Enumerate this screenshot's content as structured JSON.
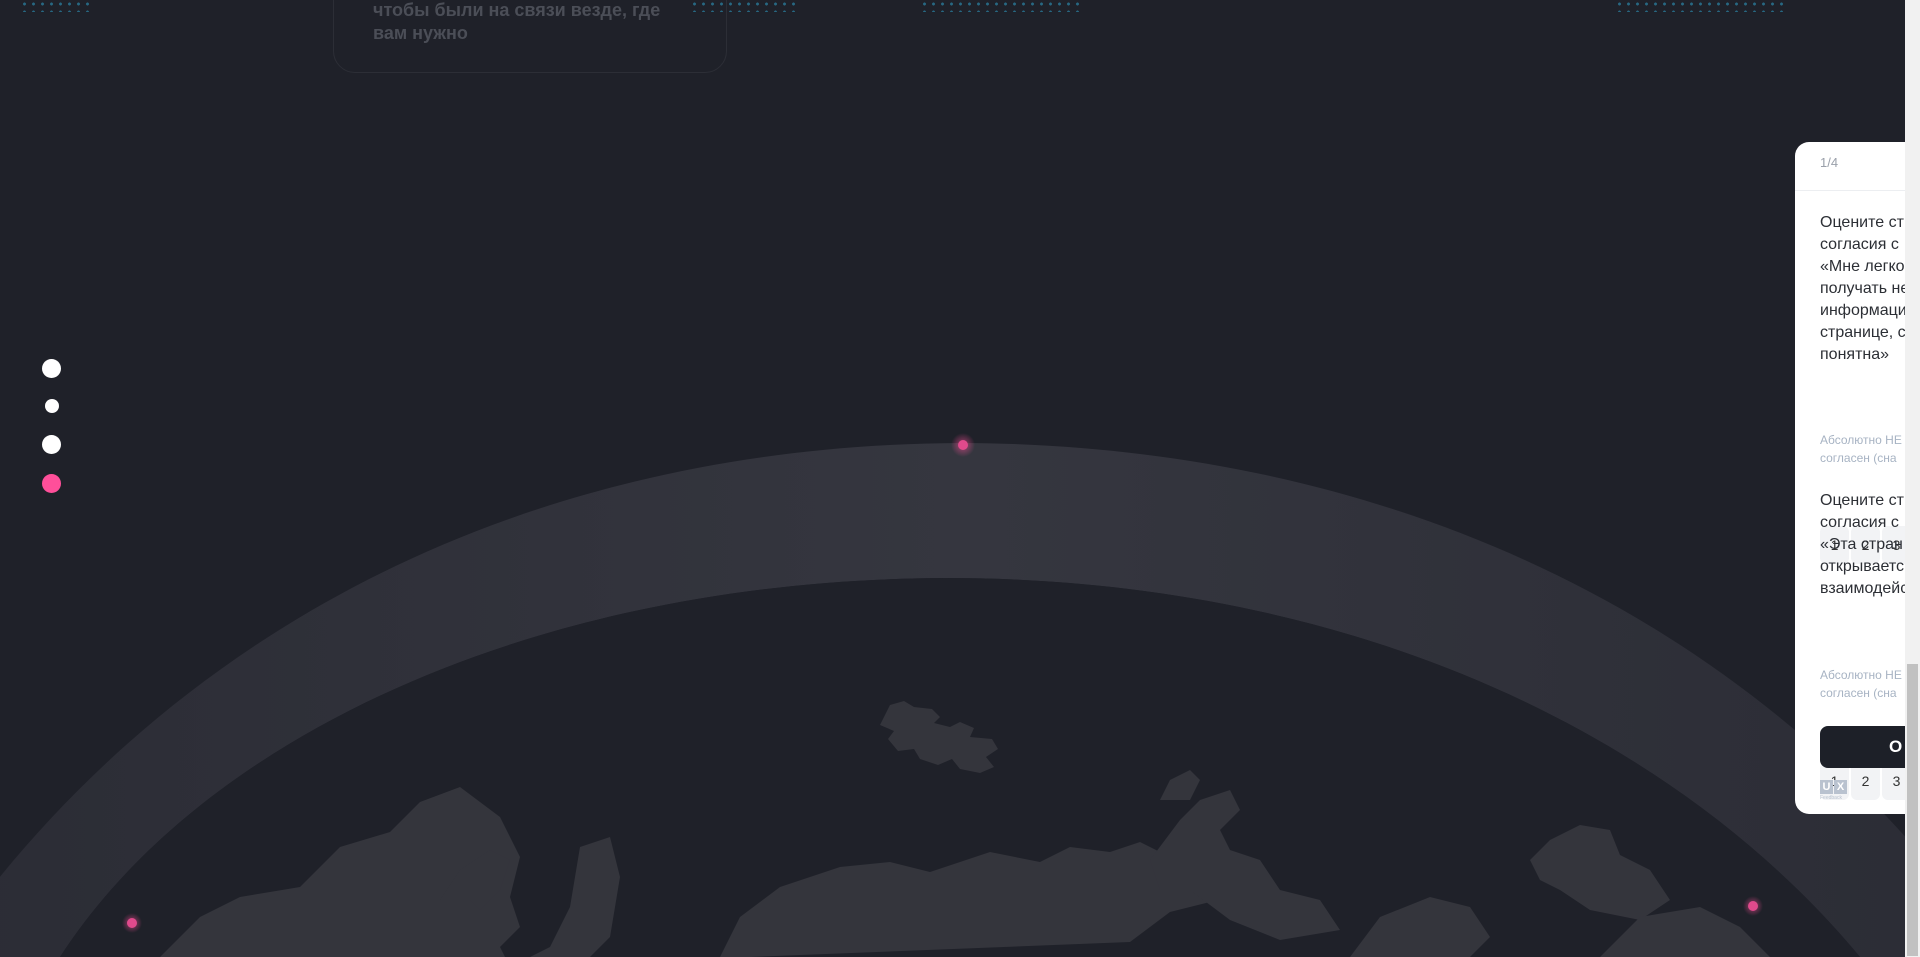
{
  "top_card": {
    "text": "чтобы были на связи везде, где вам нужно"
  },
  "side_nav": {
    "items": [
      {
        "label": "",
        "active": false
      },
      {
        "label": "",
        "active": false
      },
      {
        "label": "",
        "active": false
      },
      {
        "label": "",
        "active": true
      }
    ],
    "colors": {
      "inactive": "#ffffff",
      "active": "#ff4f9a"
    }
  },
  "globe": {
    "accent_color": "#e04a8c",
    "ring_color": "#35363f",
    "land_color": "#34353c"
  },
  "feedback": {
    "counter": "1/4",
    "questions": [
      {
        "text": "Оцените ст\nсогласия с\n«Мне легко\nполучать не\nинформаци\nстранице, с\nпонятна»",
        "scale": [
          "1",
          "2",
          "3"
        ],
        "hint": "Абсолютно НЕ\nсогласен (сна"
      },
      {
        "text": "Оцените ст\nсогласия с\n«Эта стран\nоткрываетс\nвзаимодейс",
        "scale": [
          "1",
          "2",
          "3"
        ],
        "hint": "Абсолютно НЕ\nсогласен (сна"
      }
    ],
    "submit_label": "О",
    "logo": {
      "u": "U",
      "x": "X",
      "caption": "Feedback"
    }
  },
  "colors": {
    "background": "#1f2129",
    "accent_pink": "#ff4f9a"
  }
}
